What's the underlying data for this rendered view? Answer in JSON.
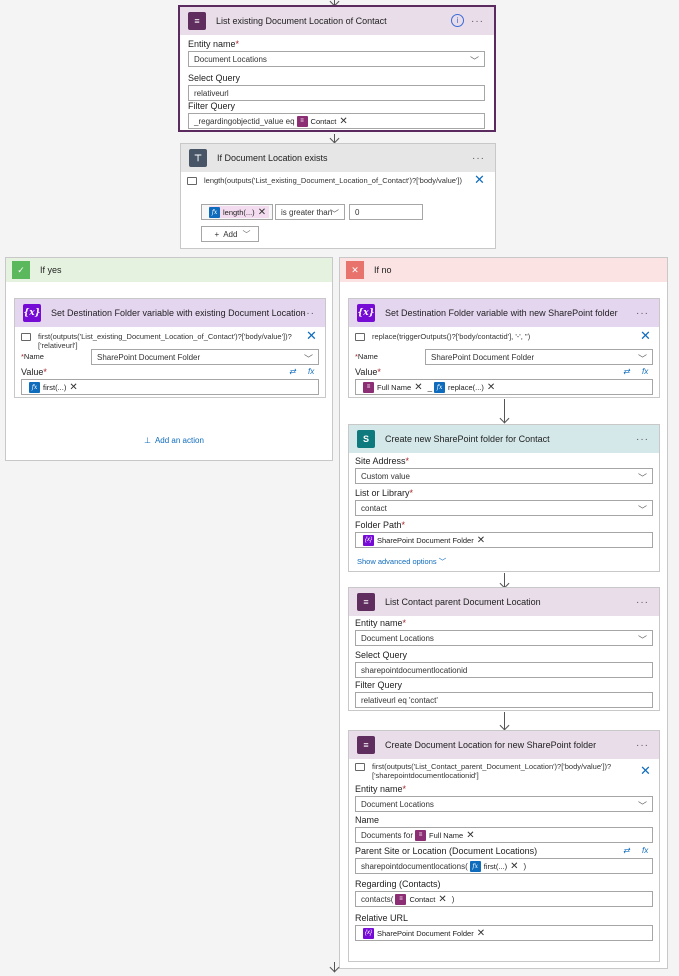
{
  "top_action": {
    "title": "List existing Document Location of Contact",
    "entity_label": "Entity name",
    "entity_value": "Document Locations",
    "select_label": "Select Query",
    "select_value": "relativeurl",
    "filter_label": "Filter Query",
    "filter_prefix": "_regardingobjectid_value eq",
    "filter_token": "Contact"
  },
  "condition": {
    "title": "If Document Location exists",
    "comment": "length(outputs('List_existing_Document_Location_of_Contact')?['body/value'])",
    "token": "length(...)",
    "operator": "is greater than",
    "value": "0",
    "add_label": "Add"
  },
  "yes_branch": {
    "label": "If yes",
    "action_title": "Set Destination Folder variable with existing Document Location",
    "comment": "first(outputs('List_existing_Document_Location_of_Contact')?['body/value'])?['relativeurl']",
    "name_label": "Name",
    "name_value": "SharePoint Document Folder",
    "value_label": "Value",
    "value_token": "first(...)",
    "add_action": "Add an action"
  },
  "no_branch": {
    "label": "If no",
    "set_var": {
      "title": "Set Destination Folder variable with new SharePoint folder",
      "comment": "replace(triggerOutputs()?['body/contactid'], '-', '')",
      "name_label": "Name",
      "name_value": "SharePoint Document Folder",
      "value_label": "Value",
      "token_name": "Full Name",
      "separator": "_",
      "token_fx": "replace(...)"
    },
    "create_folder": {
      "title": "Create new SharePoint folder for Contact",
      "site_label": "Site Address",
      "site_value": "Custom value",
      "list_label": "List or Library",
      "list_value": "contact",
      "path_label": "Folder Path",
      "path_token": "SharePoint Document Folder",
      "advanced": "Show advanced options"
    },
    "list_parent": {
      "title": "List Contact parent Document Location",
      "entity_label": "Entity name",
      "entity_value": "Document Locations",
      "select_label": "Select Query",
      "select_value": "sharepointdocumentlocationid",
      "filter_label": "Filter Query",
      "filter_value": "relativeurl eq 'contact'"
    },
    "create_loc": {
      "title": "Create Document Location for new SharePoint folder",
      "comment_line1": "first(outputs('List_Contact_parent_Document_Location')?['body/value'])?",
      "comment_line2": "['sharepointdocumentlocationid']",
      "entity_label": "Entity name",
      "entity_value": "Document Locations",
      "name_label": "Name",
      "name_prefix": "Documents for",
      "name_token": "Full Name",
      "parent_label": "Parent Site or Location (Document Locations)",
      "parent_prefix": "sharepointdocumentlocations(",
      "parent_token": "first(...)",
      "parent_suffix": ")",
      "regarding_label": "Regarding (Contacts)",
      "regarding_prefix": "contacts(",
      "regarding_token": "Contact",
      "regarding_suffix": ")",
      "url_label": "Relative URL",
      "url_token": "SharePoint Document Folder"
    }
  },
  "icons": {
    "dataverse": "database-icon",
    "variable": "variable-icon",
    "sharepoint": "sharepoint-icon",
    "condition": "condition-icon",
    "fx": "fx-icon"
  },
  "colors": {
    "dataverse_header": "#e8dde9",
    "variable_header": "#e5d6f0",
    "sharepoint_header": "#d4e8ea",
    "yes_header": "#e6f2e0",
    "no_header": "#fbe3e3",
    "accent": "#0f6cbd"
  }
}
